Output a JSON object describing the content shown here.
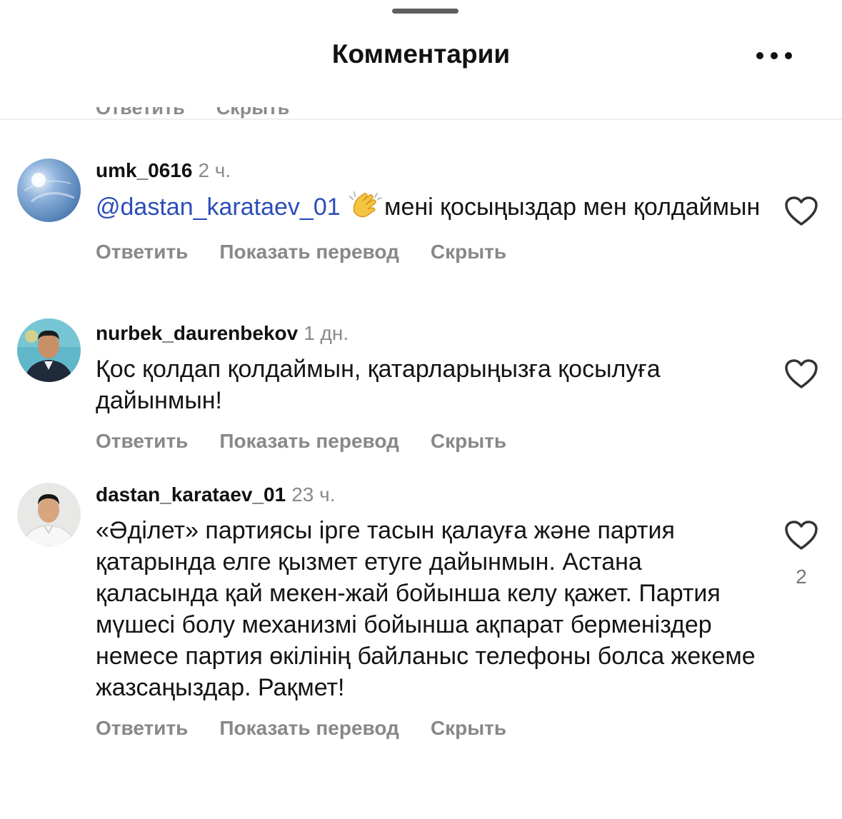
{
  "header": {
    "title": "Комментарии"
  },
  "previous_actions": {
    "reply": "Ответить",
    "hide": "Скрыть"
  },
  "comments": [
    {
      "username": "umk_0616",
      "time": "2 ч.",
      "mention": "@dastan_karataev_01",
      "emoji": "clapping-hands",
      "text": "мені қосыңыздар мен қолдаймын",
      "actions": {
        "reply": "Ответить",
        "translate": "Показать перевод",
        "hide": "Скрыть"
      },
      "likes": ""
    },
    {
      "username": "nurbek_daurenbekov",
      "time": "1 дн.",
      "text": "Қос қолдап қолдаймын, қатарларыңызға қосылуға  дайынмын!",
      "actions": {
        "reply": "Ответить",
        "translate": "Показать перевод",
        "hide": "Скрыть"
      },
      "likes": ""
    },
    {
      "username": "dastan_karataev_01",
      "time": "23 ч.",
      "text": "«Әділет» партиясы іргe тасын қалауға және партия қатарында елге қызмет етуге дайынмын. Астана қаласында қай мекен-жай бойынша келу қажет. Партия мүшесі болу механизмі бойынша ақпарат берменіздер немесе партия өкілінің байланыс телефоны болса жекеме жазсаңыздар. Рақмет!",
      "actions": {
        "reply": "Ответить",
        "translate": "Показать перевод",
        "hide": "Скрыть"
      },
      "likes": "2"
    }
  ],
  "icons": {
    "more": "more-horizontal-icon",
    "like": "heart-outline-icon"
  },
  "colors": {
    "mention": "#2c4db8",
    "secondary_text": "#888888",
    "primary_text": "#141414"
  }
}
